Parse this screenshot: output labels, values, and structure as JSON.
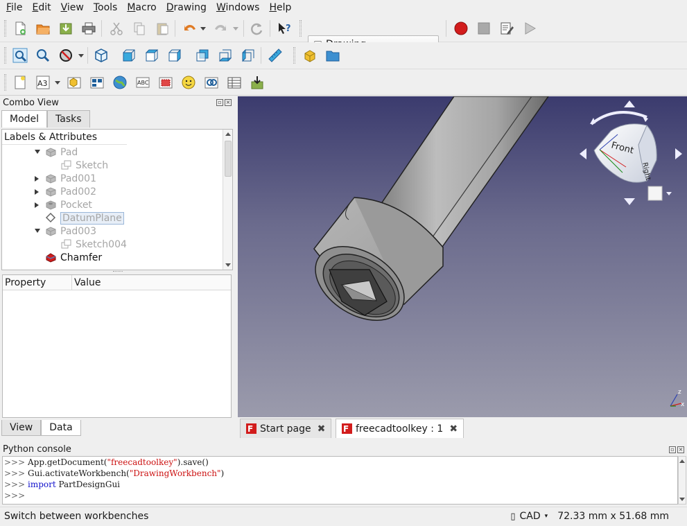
{
  "menu": [
    {
      "label": "File",
      "mnemonic": "F",
      "rest": "ile"
    },
    {
      "label": "Edit",
      "mnemonic": "E",
      "rest": "dit"
    },
    {
      "label": "View",
      "mnemonic": "V",
      "rest": "iew"
    },
    {
      "label": "Tools",
      "mnemonic": "T",
      "rest": "ools"
    },
    {
      "label": "Macro",
      "mnemonic": "M",
      "rest": "acro"
    },
    {
      "label": "Drawing",
      "mnemonic": "D",
      "rest": "rawing"
    },
    {
      "label": "Windows",
      "mnemonic": "W",
      "rest": "indows"
    },
    {
      "label": "Help",
      "mnemonic": "H",
      "rest": "elp"
    }
  ],
  "workbench": {
    "selected": "Drawing"
  },
  "combo_view": {
    "title": "Combo View",
    "tabs": [
      "Model",
      "Tasks"
    ],
    "tree_header": "Labels & Attributes",
    "tree_items": [
      {
        "label": "Pad",
        "expander": "down",
        "icon": "pad-icon"
      },
      {
        "label": "Sketch",
        "expander": "",
        "icon": "sketch-icon"
      },
      {
        "label": "Pad001",
        "expander": "right",
        "icon": "pad-icon"
      },
      {
        "label": "Pad002",
        "expander": "right",
        "icon": "pad-icon"
      },
      {
        "label": "Pocket",
        "expander": "right",
        "icon": "pocket-icon"
      },
      {
        "label": "DatumPlane",
        "expander": "",
        "icon": "datum-plane-icon",
        "selected": true
      },
      {
        "label": "Pad003",
        "expander": "down",
        "icon": "pad-icon"
      },
      {
        "label": "Sketch004",
        "expander": "",
        "icon": "sketch-icon"
      },
      {
        "label": "Chamfer",
        "expander": "",
        "icon": "chamfer-icon",
        "active": true
      }
    ],
    "property_columns": [
      "Property",
      "Value"
    ],
    "bottom_tabs": [
      "View",
      "Data"
    ]
  },
  "navicube": {
    "face_front": "Front",
    "face_right": "Right"
  },
  "axis": {
    "z": "z",
    "x": "x"
  },
  "doc_tabs": [
    {
      "label": "Start page",
      "active": false
    },
    {
      "label": "freecadtoolkey : 1",
      "active": true
    }
  ],
  "python_console": {
    "title": "Python console",
    "lines": [
      {
        "prompt": ">>> ",
        "parts": [
          {
            "t": "App.getDocument(",
            "c": "plain"
          },
          {
            "t": "\"freecadtoolkey\"",
            "c": "str"
          },
          {
            "t": ").save()",
            "c": "plain"
          }
        ]
      },
      {
        "prompt": ">>> ",
        "parts": [
          {
            "t": "Gui.activateWorkbench(",
            "c": "plain"
          },
          {
            "t": "\"DrawingWorkbench\"",
            "c": "str"
          },
          {
            "t": ")",
            "c": "plain"
          }
        ]
      },
      {
        "prompt": ">>> ",
        "parts": [
          {
            "t": "import",
            "c": "kw"
          },
          {
            "t": " PartDesignGui",
            "c": "plain"
          }
        ]
      },
      {
        "prompt": ">>> ",
        "parts": []
      }
    ]
  },
  "status": {
    "message": "Switch between workbenches",
    "nav_style": "CAD",
    "dimensions": "72.33 mm x 51.68 mm"
  },
  "colors": {
    "record": "#d21c1c",
    "accent_blue": "#2a7fc4",
    "view_cube_face": "#e8ebf2"
  }
}
